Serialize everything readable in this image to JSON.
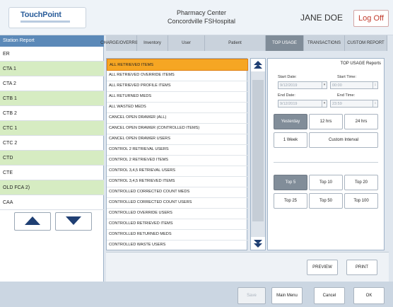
{
  "header": {
    "logo_text": "TouchPoint",
    "app_title_line1": "Pharmacy Center",
    "app_title_line2": "Concordville FSHospital",
    "user_name": "JANE DOE",
    "logoff_label": "Log Off"
  },
  "stations": {
    "header": "Station Report",
    "items": [
      "ER",
      "CTA 1",
      "CTA 2",
      "CTB 1",
      "CTB 2",
      "CTC 1",
      "CTC 2",
      "CTD",
      "CTE",
      "OLD FCA 2)",
      "CAA"
    ]
  },
  "tabs": [
    {
      "label": "CHARGE/OVERRIDE",
      "active": false
    },
    {
      "label": "Inventory",
      "active": false
    },
    {
      "label": "User",
      "active": false
    },
    {
      "label": "Patient",
      "active": false
    },
    {
      "label": "TOP USAGE",
      "active": true
    },
    {
      "label": "TRANSACTIONS",
      "active": false
    },
    {
      "label": "CUSTOM REPORT",
      "active": false
    }
  ],
  "report_list": {
    "selected_index": 0,
    "items": [
      "ALL RETRIEVED ITEMS",
      "ALL RETRIEVED OVERRIDE ITEMS",
      "ALL RETRIEVED PROFILE ITEMS",
      "ALL RETURNED MEDS",
      "ALL WASTED MEDS",
      "CANCEL OPEN DRAWER (ALL)",
      "CANCEL OPEN DRAWER (CONTROLLED ITEMS)",
      "CANCEL OPEN DRAWER USERS",
      "CONTROL 2 RETRIEVAL USERS",
      "CONTROL 2 RETRIEVED ITEMS",
      "CONTROL 3,4,5 RETRIEVAL USERS",
      "CONTROL 3,4,5 RETRIEVED ITEMS",
      "CONTROLLED CORRECTED COUNT MEDS",
      "CONTROLLED CORRECTED COUNT USERS",
      "CONTROLLED OVERRIDE USERS",
      "CONTROLLED RETRIEVED ITEMS",
      "CONTROLLED RETURNED MEDS",
      "CONTROLLED WASTE USERS"
    ]
  },
  "right_panel": {
    "title": "TOP USAGE Reports",
    "start_date_label": "Start Date:",
    "start_date_value": "9/12/2019",
    "start_time_label": "Start Time:",
    "start_time_value": "00:00",
    "end_date_label": "End Date:",
    "end_date_value": "9/12/2019",
    "end_time_label": "End Time:",
    "end_time_value": "23:59",
    "period_buttons": [
      {
        "label": "Yesterday",
        "selected": true
      },
      {
        "label": "12 hrs",
        "selected": false
      },
      {
        "label": "24 hrs",
        "selected": false
      },
      {
        "label": "1 Week",
        "selected": false
      },
      {
        "label": "Custom Interval",
        "selected": false
      }
    ],
    "top_buttons": [
      {
        "label": "Top 5",
        "selected": true
      },
      {
        "label": "Top 10",
        "selected": false
      },
      {
        "label": "Top 20",
        "selected": false
      },
      {
        "label": "Top 25",
        "selected": false
      },
      {
        "label": "Top 50",
        "selected": false
      },
      {
        "label": "Top 100",
        "selected": false
      }
    ]
  },
  "actions": {
    "preview_label": "PREVIEW",
    "print_label": "PRINT"
  },
  "bottom_bar": {
    "save_label": "Save",
    "main_menu_label": "Main Menu",
    "cancel_label": "Cancel",
    "ok_label": "OK"
  }
}
